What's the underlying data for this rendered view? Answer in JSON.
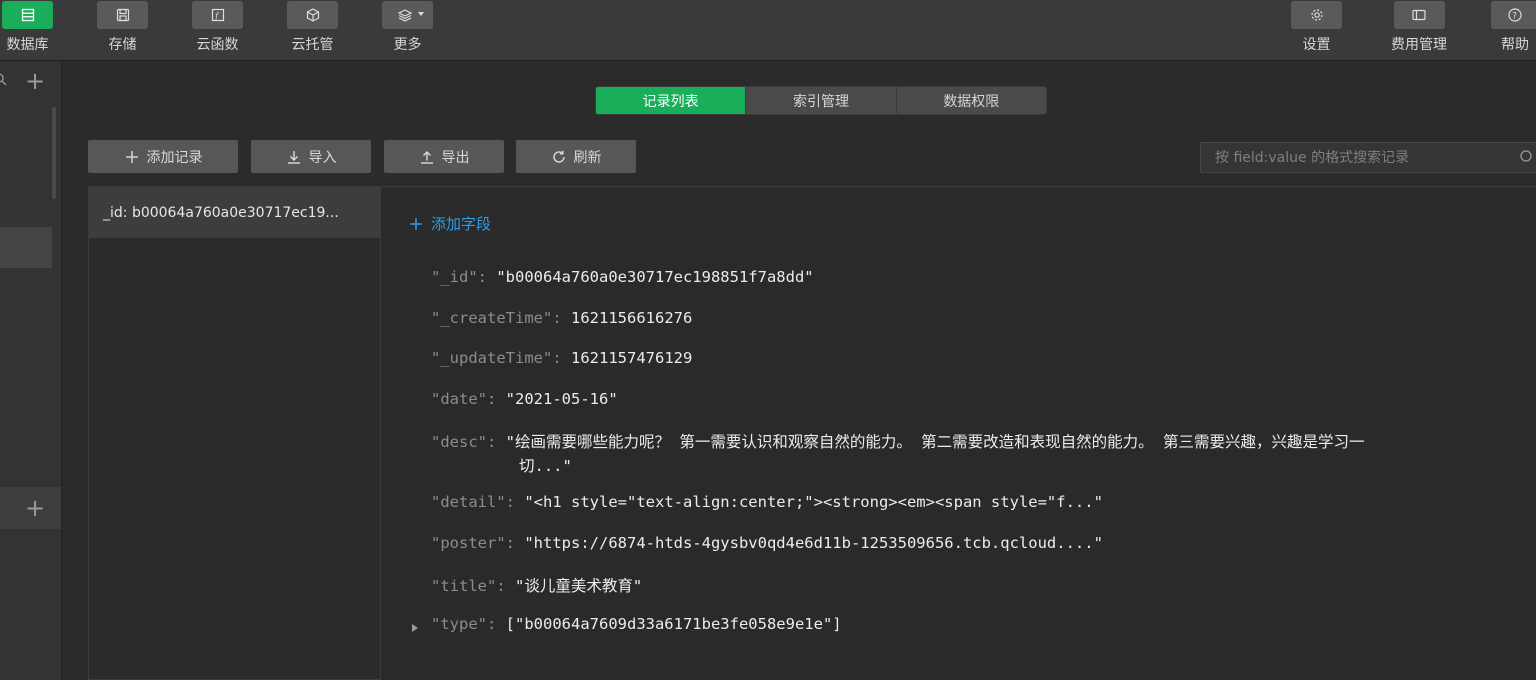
{
  "toolbar": {
    "left": [
      {
        "label": "数据库",
        "icon": "database-icon",
        "active": true
      },
      {
        "label": "存储",
        "icon": "storage-icon"
      },
      {
        "label": "云函数",
        "icon": "cloud-function-icon"
      },
      {
        "label": "云托管",
        "icon": "cloud-hosting-icon"
      },
      {
        "label": "更多",
        "icon": "layers-more-icon"
      }
    ],
    "right": [
      {
        "label": "设置",
        "icon": "gear-icon"
      },
      {
        "label": "费用管理",
        "icon": "billing-icon"
      },
      {
        "label": "帮助",
        "icon": "help-icon"
      }
    ]
  },
  "tabs": [
    "记录列表",
    "索引管理",
    "数据权限"
  ],
  "actions": {
    "add": "添加记录",
    "import": "导入",
    "export": "导出",
    "refresh": "刷新"
  },
  "search": {
    "placeholder": "按 field:value 的格式搜索记录"
  },
  "records": [
    "_id: b00064a760a0e30717ec19..."
  ],
  "detail": {
    "add_field": "添加字段",
    "fields": [
      {
        "key": "\"_id\":",
        "value": "\"b00064a760a0e30717ec198851f7a8dd\""
      },
      {
        "key": "\"_createTime\":",
        "value": "1621156616276"
      },
      {
        "key": "\"_updateTime\":",
        "value": "1621157476129"
      },
      {
        "key": "\"date\":",
        "value": "\"2021-05-16\""
      },
      {
        "key": "\"desc\":",
        "value": "\"绘画需要哪些能力呢？ 第一需要认识和观察自然的能力。 第二需要改造和表现自然的能力。 第三需要兴趣，兴趣是学习一",
        "value2": "切...\""
      },
      {
        "key": "\"detail\":",
        "value": "\"<h1 style=\"text-align:center;\"><strong><em><span style=\"f...\""
      },
      {
        "key": "\"poster\":",
        "value": "\"https://6874-htds-4gysbv0qd4e6d11b-1253509656.tcb.qcloud....\""
      },
      {
        "key": "\"title\":",
        "value": "\"谈儿童美术教育\""
      },
      {
        "key": "\"type\":",
        "value": "[\"b00064a7609d33a6171be3fe058e9e1e\"]"
      }
    ]
  },
  "colors": {
    "accent": "#1aad5a",
    "link": "#2f9be8"
  }
}
